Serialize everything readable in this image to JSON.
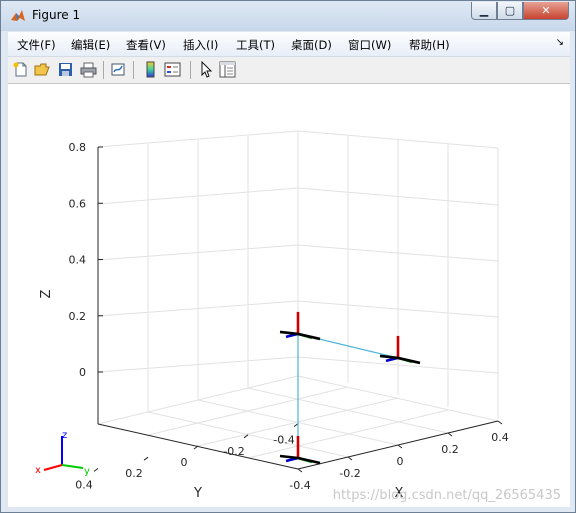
{
  "window": {
    "title": "Figure 1"
  },
  "menu": [
    "文件(F)",
    "编辑(E)",
    "查看(V)",
    "插入(I)",
    "工具(T)",
    "桌面(D)",
    "窗口(W)",
    "帮助(H)"
  ],
  "toolbar": [
    "new-figure-icon",
    "open-icon",
    "save-icon",
    "print-icon",
    "link-plot-icon",
    "colorbar-icon",
    "legend-icon",
    "edit-plot-icon",
    "property-inspector-icon"
  ],
  "chart_data": {
    "type": "3d-line",
    "xlabel": "X",
    "ylabel": "Y",
    "zlabel": "Z",
    "x_ticks": [
      "-0.4",
      "-0.2",
      "0",
      "0.2",
      "0.4"
    ],
    "y_ticks": [
      "-0.4",
      "-0.2",
      "0",
      "0.2",
      "0.4"
    ],
    "z_ticks": [
      "0",
      "0.2",
      "0.4",
      "0.6",
      "0.8"
    ],
    "xlim": [
      -0.4,
      0.4
    ],
    "ylim": [
      -0.4,
      0.4
    ],
    "zlim": [
      -0.1,
      0.8
    ],
    "grid": true,
    "line_color": "#4db3d9",
    "series": [
      {
        "points": [
          [
            0,
            0,
            0
          ],
          [
            0,
            0,
            0.42
          ],
          [
            0,
            0,
            0.44
          ],
          [
            0.4,
            0,
            0.44
          ]
        ]
      }
    ],
    "frames": [
      [
        0,
        0,
        0
      ],
      [
        0,
        0,
        0.44
      ],
      [
        0.4,
        0,
        0.44
      ]
    ],
    "triad_labels": [
      "x",
      "y",
      "z"
    ],
    "watermark": "https://blog.csdn.net/qq_26565435"
  }
}
